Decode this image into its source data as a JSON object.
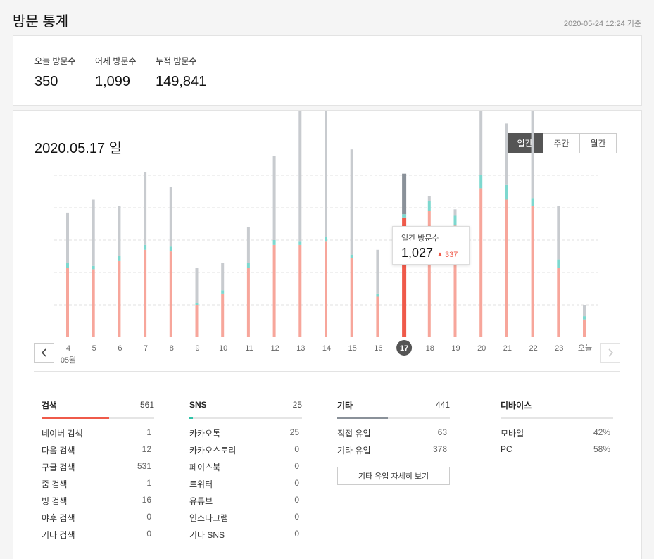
{
  "header": {
    "title": "방문 통계",
    "timestamp": "2020-05-24 12:24 기준"
  },
  "summary": [
    {
      "label": "오늘 방문수",
      "value": "350"
    },
    {
      "label": "어제 방문수",
      "value": "1,099"
    },
    {
      "label": "누적 방문수",
      "value": "149,841"
    }
  ],
  "main": {
    "date_title": "2020.05.17 일",
    "period_tabs": [
      {
        "label": "일간"
      },
      {
        "label": "주간"
      },
      {
        "label": "월간"
      }
    ],
    "active_period": "일간",
    "month_label": "05월",
    "tooltip": {
      "label": "일간 방문수",
      "value": "1,027",
      "diff": "337"
    },
    "prev_icon": "chevron-left-icon",
    "next_icon": "chevron-right-icon"
  },
  "chart_data": {
    "type": "bar",
    "categories": [
      "4",
      "5",
      "6",
      "7",
      "8",
      "9",
      "10",
      "11",
      "12",
      "13",
      "14",
      "15",
      "16",
      "17",
      "18",
      "19",
      "20",
      "21",
      "22",
      "23",
      "오늘"
    ],
    "selected": "17",
    "grid": true,
    "series": [
      {
        "values": [
          430,
          420,
          470,
          540,
          530,
          200,
          270,
          430,
          570,
          570,
          590,
          490,
          250,
          740,
          780,
          690,
          920,
          850,
          810,
          430,
          110
        ]
      },
      {
        "values": [
          30,
          20,
          30,
          30,
          30,
          10,
          20,
          30,
          30,
          20,
          30,
          20,
          20,
          20,
          60,
          60,
          80,
          90,
          50,
          50,
          20
        ]
      },
      {
        "values": [
          310,
          410,
          310,
          450,
          370,
          220,
          170,
          220,
          520,
          830,
          900,
          650,
          270,
          250,
          30,
          40,
          430,
          380,
          680,
          330,
          70
        ]
      }
    ],
    "colors": {
      "search": "#f7a69b",
      "sns": "#7dd8cf",
      "other": "#c8cbcf",
      "selected_search": "#ef5a4a",
      "selected_other": "#8a9199",
      "selected_axis": "#555555"
    }
  },
  "breakdown": [
    {
      "title": "검색",
      "count": "561",
      "bar_color": "#ef5a4a",
      "bar_fill": 0.6,
      "rows": [
        {
          "label": "네이버 검색",
          "value": "1"
        },
        {
          "label": "다음 검색",
          "value": "12"
        },
        {
          "label": "구글 검색",
          "value": "531"
        },
        {
          "label": "줌 검색",
          "value": "1"
        },
        {
          "label": "빙 검색",
          "value": "16"
        },
        {
          "label": "야후 검색",
          "value": "0"
        },
        {
          "label": "기타 검색",
          "value": "0"
        }
      ]
    },
    {
      "title": "SNS",
      "count": "25",
      "bar_color": "#2fc4a8",
      "bar_fill": 0.03,
      "rows": [
        {
          "label": "카카오톡",
          "value": "25"
        },
        {
          "label": "카카오스토리",
          "value": "0"
        },
        {
          "label": "페이스북",
          "value": "0"
        },
        {
          "label": "트위터",
          "value": "0"
        },
        {
          "label": "유튜브",
          "value": "0"
        },
        {
          "label": "인스타그램",
          "value": "0"
        },
        {
          "label": "기타 SNS",
          "value": "0"
        }
      ]
    },
    {
      "title": "기타",
      "count": "441",
      "bar_color": "#8a9199",
      "bar_fill": 0.45,
      "rows": [
        {
          "label": "직접 유입",
          "value": "63"
        },
        {
          "label": "기타 유입",
          "value": "378"
        }
      ],
      "button_label": "기타 유입 자세히 보기"
    },
    {
      "title": "디바이스",
      "count": "",
      "bar_color": "#e5e5e5",
      "bar_fill": 0,
      "rows": [
        {
          "label": "모바일",
          "value": "42%"
        },
        {
          "label": "PC",
          "value": "58%"
        }
      ]
    }
  ]
}
